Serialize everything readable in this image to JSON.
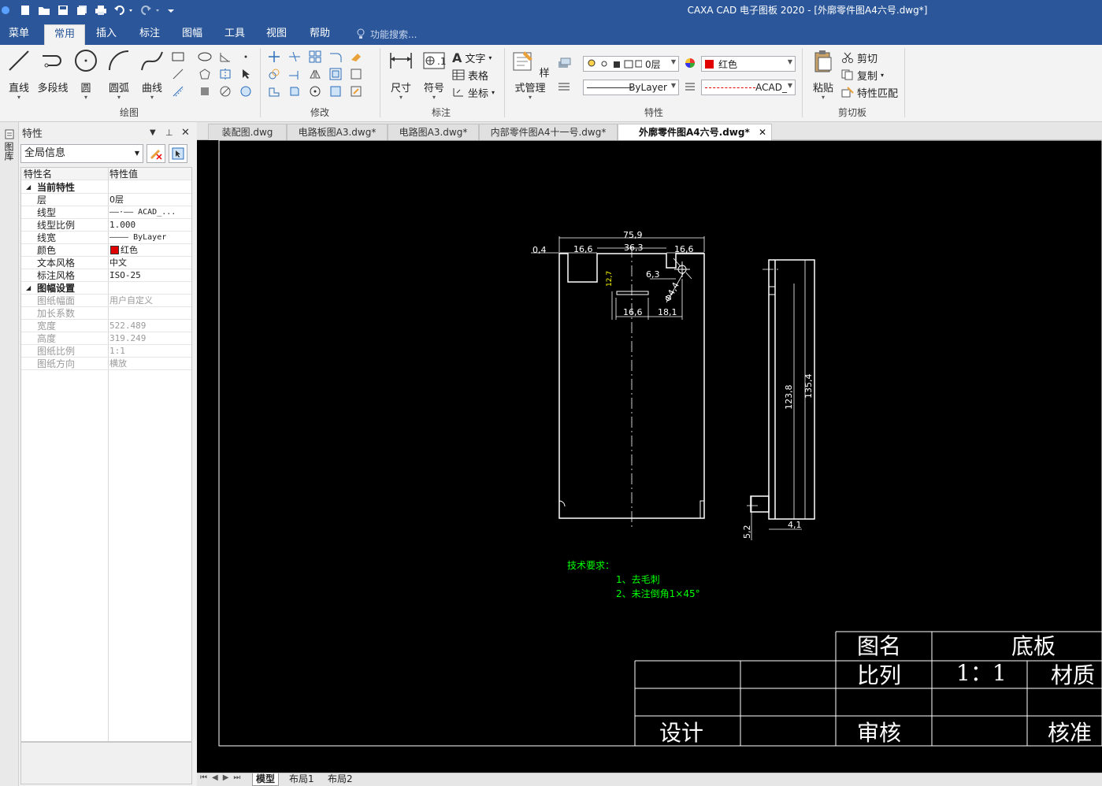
{
  "app": {
    "title": "CAXA CAD 电子图板 2020 - [外廓零件图A4六号.dwg*]"
  },
  "ribbon_tabs": [
    "菜单",
    "常用",
    "插入",
    "标注",
    "图幅",
    "工具",
    "视图",
    "帮助"
  ],
  "active_tab": "常用",
  "search": {
    "placeholder": "功能搜索..."
  },
  "ribbon": {
    "draw": {
      "label": "绘图",
      "line": "直线",
      "polyline": "多段线",
      "circle": "圆",
      "arc": "圆弧",
      "curve": "曲线"
    },
    "modify": {
      "label": "修改"
    },
    "annotate": {
      "label": "标注",
      "dimension": "尺寸",
      "symbol": "符号",
      "text": "文字",
      "table": "表格",
      "coordinate": "坐标"
    },
    "properties": {
      "label": "特性",
      "style_manager": "样式管理",
      "layer": "0层",
      "color": "红色",
      "color_hex": "#e00000",
      "linetype_bylayer": "ByLayer",
      "linetype_acad": "ACAD_"
    },
    "clipboard": {
      "label": "剪切板",
      "paste": "粘贴",
      "cut": "剪切",
      "copy": "复制",
      "match": "特性匹配"
    }
  },
  "left_strip": {
    "label": "图库"
  },
  "props_panel": {
    "title": "特性",
    "scope": "全局信息",
    "col_name": "特性名",
    "col_value": "特性值",
    "rows": [
      {
        "name": "当前特性",
        "value": ""
      },
      {
        "name": "层",
        "value": "0层"
      },
      {
        "name": "线型",
        "value": "——·—— ACAD_..."
      },
      {
        "name": "线型比例",
        "value": "1.000"
      },
      {
        "name": "线宽",
        "value": "———— ByLayer"
      },
      {
        "name": "颜色",
        "value": "红色"
      },
      {
        "name": "文本风格",
        "value": "中文"
      },
      {
        "name": "标注风格",
        "value": "ISO-25"
      },
      {
        "name": "图幅设置",
        "value": ""
      },
      {
        "name": "图纸幅面",
        "value": "用户自定义"
      },
      {
        "name": "加长系数",
        "value": ""
      },
      {
        "name": "宽度",
        "value": "522.489"
      },
      {
        "name": "高度",
        "value": "319.249"
      },
      {
        "name": "图纸比例",
        "value": "1:1"
      },
      {
        "name": "图纸方向",
        "value": "横放"
      }
    ]
  },
  "doc_tabs": [
    "装配图.dwg",
    "电路板图A3.dwg*",
    "电路图A3.dwg*",
    "内部零件图A4十一号.dwg*",
    "外廓零件图A4六号.dwg*"
  ],
  "active_doc": "外廓零件图A4六号.dwg*",
  "layout_tabs": [
    "模型",
    "布局1",
    "布局2"
  ],
  "drawing": {
    "dims_front": {
      "overall_width": "75,9",
      "left_offset": "0,4",
      "left_step": "16,6",
      "mid_step": "36,3",
      "right_step": "16,6",
      "small_dim": "6,3",
      "hole_dia": "Φ4,4",
      "slot_h": "12,7",
      "slot_w": "16,6",
      "slot_x": "18,1"
    },
    "dims_side": {
      "height_outer": "135,4",
      "height_inner": "123,8",
      "thickness": "4,1",
      "foot": "5,2"
    },
    "tech_title": "技术要求：",
    "tech_items": [
      "1、去毛刺",
      "2、未注倒角1×45°"
    ],
    "title_block": {
      "name_label": "图名",
      "name_value": "底板",
      "scale_label": "比列",
      "scale_value": "1：1",
      "material_label": "材质",
      "design_label": "设计",
      "review_label": "审核",
      "approve_label": "核准"
    }
  }
}
